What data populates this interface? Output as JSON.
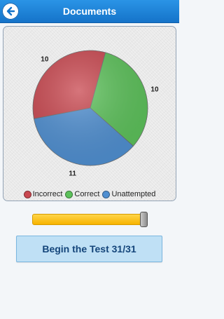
{
  "header": {
    "title": "Documents",
    "back_icon": "back-arrow-icon"
  },
  "chart_data": {
    "type": "pie",
    "title": "",
    "slices": [
      {
        "label": "Incorrect",
        "value": 10,
        "color": "#c9474f"
      },
      {
        "label": "Correct",
        "value": 10,
        "color": "#5cc15a"
      },
      {
        "label": "Unattempted",
        "value": 11,
        "color": "#4f8fd1"
      }
    ],
    "legend_position": "bottom"
  },
  "progress": {
    "value": 31,
    "max": 31,
    "color": "#f7b300"
  },
  "action": {
    "begin_label": "Begin the Test 31/31"
  }
}
